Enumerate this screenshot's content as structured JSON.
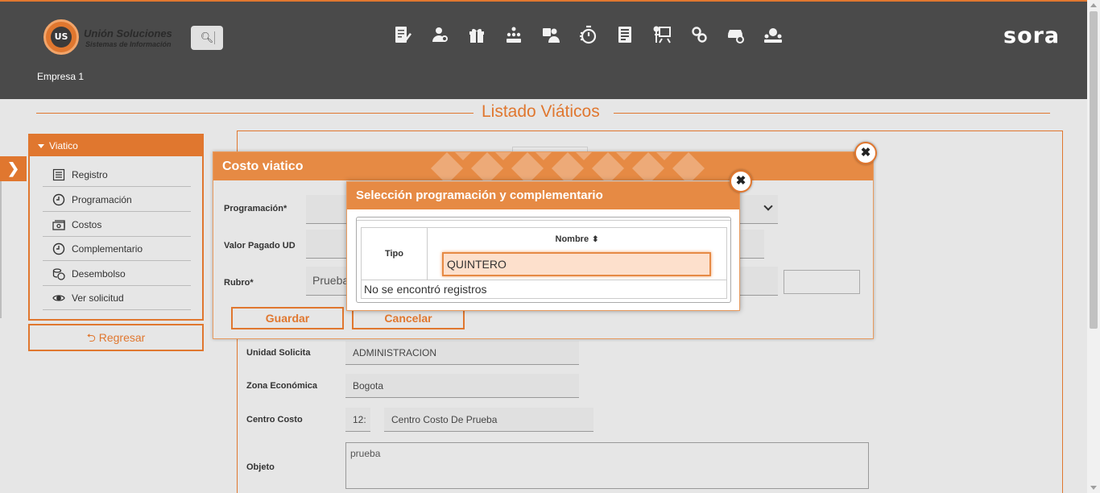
{
  "header": {
    "logo": {
      "badge": "union US",
      "name": "Unión Soluciones",
      "subtitle": "Sistemas de Información"
    },
    "search_icon": "search-icon",
    "brand": "sora",
    "company": "Empresa 1",
    "modules": [
      "document-edit-icon",
      "user-settings-icon",
      "gift-icon",
      "team-hierarchy-icon",
      "id-user-icon",
      "stopwatch-icon",
      "report-list-icon",
      "presentation-board-icon",
      "gears-icon",
      "car-settings-icon",
      "support-group-icon"
    ]
  },
  "page": {
    "title": "Listado Viáticos"
  },
  "sidebar": {
    "header": "Viatico",
    "items": [
      {
        "label": "Registro",
        "icon": "list-icon"
      },
      {
        "label": "Programación",
        "icon": "clock-icon"
      },
      {
        "label": "Costos",
        "icon": "money-icon"
      },
      {
        "label": "Complementario",
        "icon": "clock-icon"
      },
      {
        "label": "Desembolso",
        "icon": "coins-icon"
      },
      {
        "label": "Ver solicitud",
        "icon": "eye-icon"
      }
    ],
    "back_label": "Regresar"
  },
  "form": {
    "unidad_label": "Unidad Solicita",
    "unidad_value": "ADMINISTRACION",
    "zona_label": "Zona Económica",
    "zona_value": "Bogota",
    "centro_label": "Centro Costo",
    "centro_code": "12:",
    "centro_value": "Centro Costo De Prueba",
    "objeto_label": "Objeto",
    "objeto_value": "prueba"
  },
  "dialog_costo": {
    "title": "Costo viatico",
    "programacion_label": "Programación*",
    "valor_label": "Valor Pagado UD",
    "rubro_label": "Rubro*",
    "rubro_value": "Prueba",
    "save_label": "Guardar",
    "cancel_label": "Cancelar"
  },
  "dialog_seleccion": {
    "title": "Selección programación y complementario",
    "col_tipo": "Tipo",
    "col_nombre": "Nombre",
    "filter_value": "QUINTERO",
    "empty_message": "No se encontró registros"
  },
  "colors": {
    "accent": "#e0772f",
    "header_bg": "#4a4a4a",
    "dialog_head": "#e68a44"
  }
}
